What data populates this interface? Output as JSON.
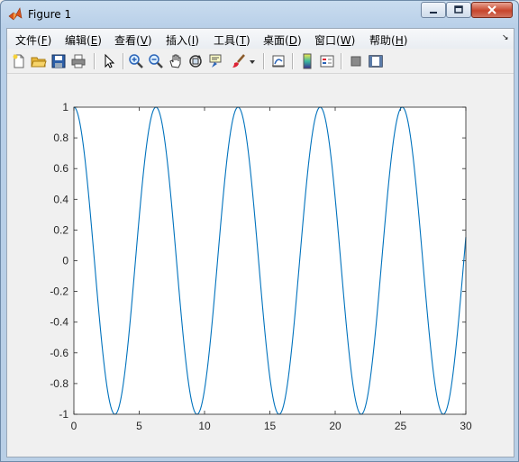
{
  "window": {
    "title": "Figure 1",
    "menus": [
      {
        "text": "文件(",
        "key": "F",
        "end": ")"
      },
      {
        "text": "编辑(",
        "key": "E",
        "end": ")"
      },
      {
        "text": "查看(",
        "key": "V",
        "end": ")"
      },
      {
        "text": "插入(",
        "key": "I",
        "end": ")"
      },
      {
        "text": "工具(",
        "key": "T",
        "end": ")"
      },
      {
        "text": "桌面(",
        "key": "D",
        "end": ")"
      },
      {
        "text": "窗口(",
        "key": "W",
        "end": ")"
      },
      {
        "text": "帮助(",
        "key": "H",
        "end": ")"
      }
    ]
  },
  "toolbar": {
    "icons": [
      "new-figure-icon",
      "open-file-icon",
      "save-icon",
      "print-icon",
      "pointer-icon",
      "zoom-in-icon",
      "zoom-out-icon",
      "pan-hand-icon",
      "rotate-3d-icon",
      "data-cursor-icon",
      "brush-icon",
      "brush-dropdown-icon",
      "link-plot-icon",
      "colorbar-icon",
      "legend-icon",
      "hide-plot-tools-icon",
      "show-plot-tools-icon"
    ]
  },
  "chart_data": {
    "type": "line",
    "title": "",
    "xlabel": "",
    "ylabel": "",
    "function": "cos(x)",
    "xlim": [
      0,
      30
    ],
    "ylim": [
      -1,
      1
    ],
    "xticks": [
      0,
      5,
      10,
      15,
      20,
      25,
      30
    ],
    "yticks": [
      -1,
      -0.8,
      -0.6,
      -0.4,
      -0.2,
      0,
      0.2,
      0.4,
      0.6,
      0.8,
      1
    ],
    "ytick_labels": [
      "-1",
      "-0.8",
      "-0.6",
      "-0.4",
      "-0.2",
      "0",
      "0.2",
      "0.4",
      "0.6",
      "0.8",
      "1"
    ],
    "series": [
      {
        "color": "#0072bd",
        "x": [
          0,
          0.5,
          1,
          1.5,
          2,
          2.5,
          3,
          3.5,
          4,
          4.5,
          5,
          5.5,
          6,
          6.5,
          7,
          7.5,
          8,
          8.5,
          9,
          9.5,
          10,
          10.5,
          11,
          11.5,
          12,
          12.5,
          13,
          13.5,
          14,
          14.5,
          15,
          15.5,
          16,
          16.5,
          17,
          17.5,
          18,
          18.5,
          19,
          19.5,
          20,
          20.5,
          21,
          21.5,
          22,
          22.5,
          23,
          23.5,
          24,
          24.5,
          25,
          25.5,
          26,
          26.5,
          27,
          27.5,
          28,
          28.5,
          29,
          29.5,
          30
        ],
        "y": [
          1,
          0.878,
          0.54,
          0.071,
          -0.416,
          -0.801,
          -0.99,
          -0.936,
          -0.654,
          -0.211,
          0.284,
          0.709,
          0.96,
          0.977,
          0.754,
          0.347,
          -0.146,
          -0.602,
          -0.911,
          -0.997,
          -0.839,
          -0.476,
          0.004,
          0.483,
          0.844,
          0.998,
          0.907,
          0.595,
          0.137,
          -0.355,
          -0.76,
          -0.979,
          -0.958,
          -0.702,
          -0.275,
          0.22,
          0.66,
          0.939,
          0.989,
          0.796,
          0.408,
          -0.079,
          -0.548,
          -0.882,
          -1.0,
          -0.873,
          -0.533,
          -0.062,
          0.424,
          0.806,
          0.991,
          0.933,
          0.647,
          0.202,
          -0.292,
          -0.715,
          -0.962,
          -0.975,
          -0.748,
          -0.339,
          0.154
        ]
      }
    ]
  },
  "colors": {
    "plot_line": "#0072bd",
    "axes_bg": "#ffffff",
    "figure_bg": "#f0f0f0"
  }
}
